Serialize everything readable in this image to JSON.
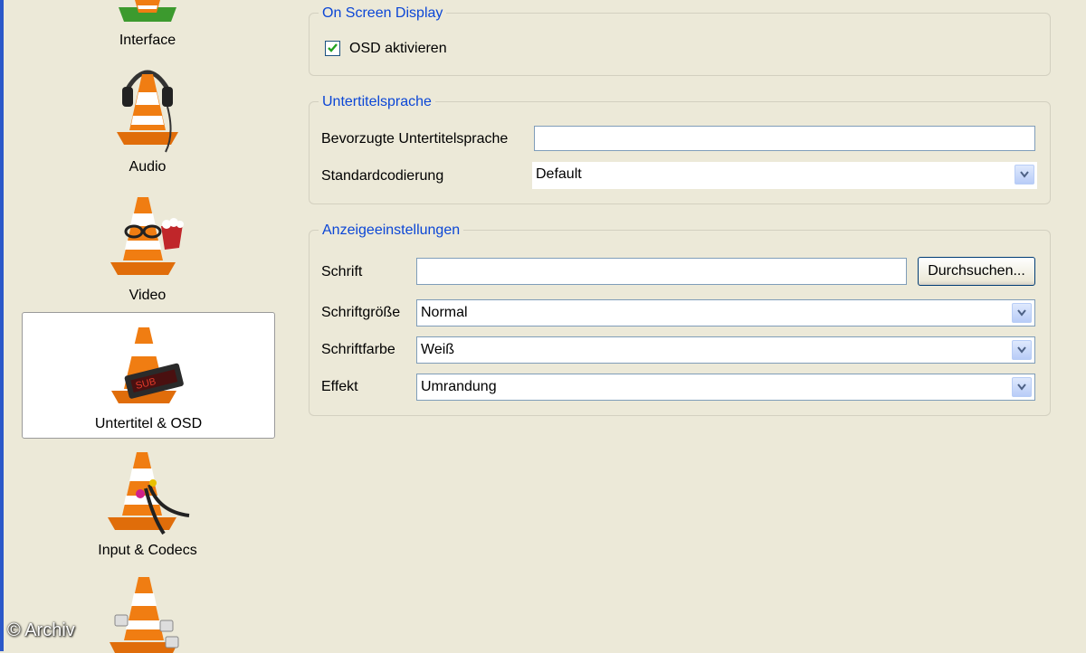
{
  "sidebar": {
    "items": [
      {
        "label": "Interface",
        "icon": "interface-cone-icon"
      },
      {
        "label": "Audio",
        "icon": "audio-cone-icon"
      },
      {
        "label": "Video",
        "icon": "video-cone-icon"
      },
      {
        "label": "Untertitel & OSD",
        "icon": "subtitle-cone-icon",
        "selected": true
      },
      {
        "label": "Input & Codecs",
        "icon": "codecs-cone-icon"
      },
      {
        "label": "",
        "icon": "hotkeys-cone-icon"
      }
    ]
  },
  "osd": {
    "title": "On Screen Display",
    "enable_label": "OSD aktivieren",
    "enabled": true
  },
  "subtitle_language": {
    "title": "Untertitelsprache",
    "preferred_label": "Bevorzugte Untertitelsprache",
    "preferred_value": "",
    "encoding_label": "Standardcodierung",
    "encoding_value": "Default"
  },
  "display": {
    "title": "Anzeigeeinstellungen",
    "font_label": "Schrift",
    "font_value": "",
    "browse_label": "Durchsuchen...",
    "size_label": "Schriftgröße",
    "size_value": "Normal",
    "color_label": "Schriftfarbe",
    "color_value": "Weiß",
    "effect_label": "Effekt",
    "effect_value": "Umrandung"
  },
  "watermark": "© Archiv",
  "colors": {
    "accent": "#0b46d6",
    "background": "#ece9d8",
    "border_blue": "#2b58c9",
    "cone_orange": "#f07d12"
  }
}
